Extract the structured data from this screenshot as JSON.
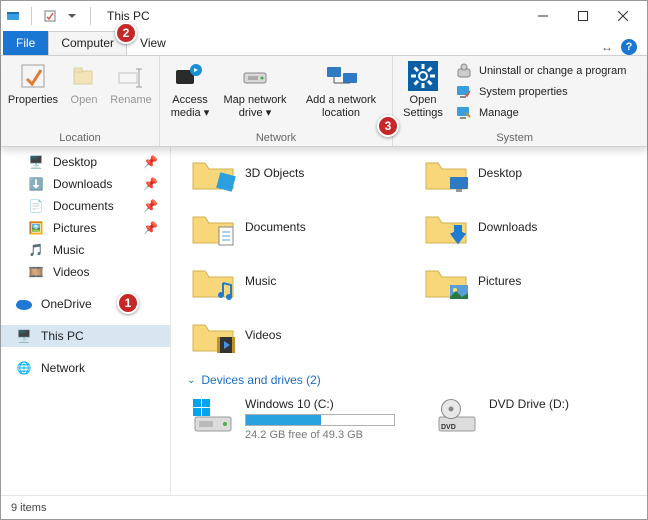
{
  "title": "This PC",
  "tabs": {
    "file": "File",
    "computer": "Computer",
    "view": "View"
  },
  "ribbon": {
    "location": {
      "label": "Location",
      "properties": "Properties",
      "open": "Open",
      "rename": "Rename"
    },
    "network": {
      "label": "Network",
      "access_media": "Access media",
      "map_drive": "Map network drive",
      "add_location": "Add a network location"
    },
    "system": {
      "label": "System",
      "open_settings": "Open Settings",
      "uninstall": "Uninstall or change a program",
      "properties": "System properties",
      "manage": "Manage"
    }
  },
  "sidebar": {
    "desktop": "Desktop",
    "downloads": "Downloads",
    "documents": "Documents",
    "pictures": "Pictures",
    "music": "Music",
    "videos": "Videos",
    "onedrive": "OneDrive",
    "thispc": "This PC",
    "network": "Network"
  },
  "content": {
    "folders": {
      "3d": "3D Objects",
      "desktop": "Desktop",
      "documents": "Documents",
      "downloads": "Downloads",
      "music": "Music",
      "pictures": "Pictures",
      "videos": "Videos"
    },
    "devices_header": "Devices and drives (2)",
    "drive_c": {
      "name": "Windows 10 (C:)",
      "sub": "24.2 GB free of 49.3 GB",
      "used_pct": 51
    },
    "drive_d": {
      "name": "DVD Drive (D:)"
    }
  },
  "status": "9 items",
  "markers": {
    "m1": "1",
    "m2": "2",
    "m3": "3"
  }
}
